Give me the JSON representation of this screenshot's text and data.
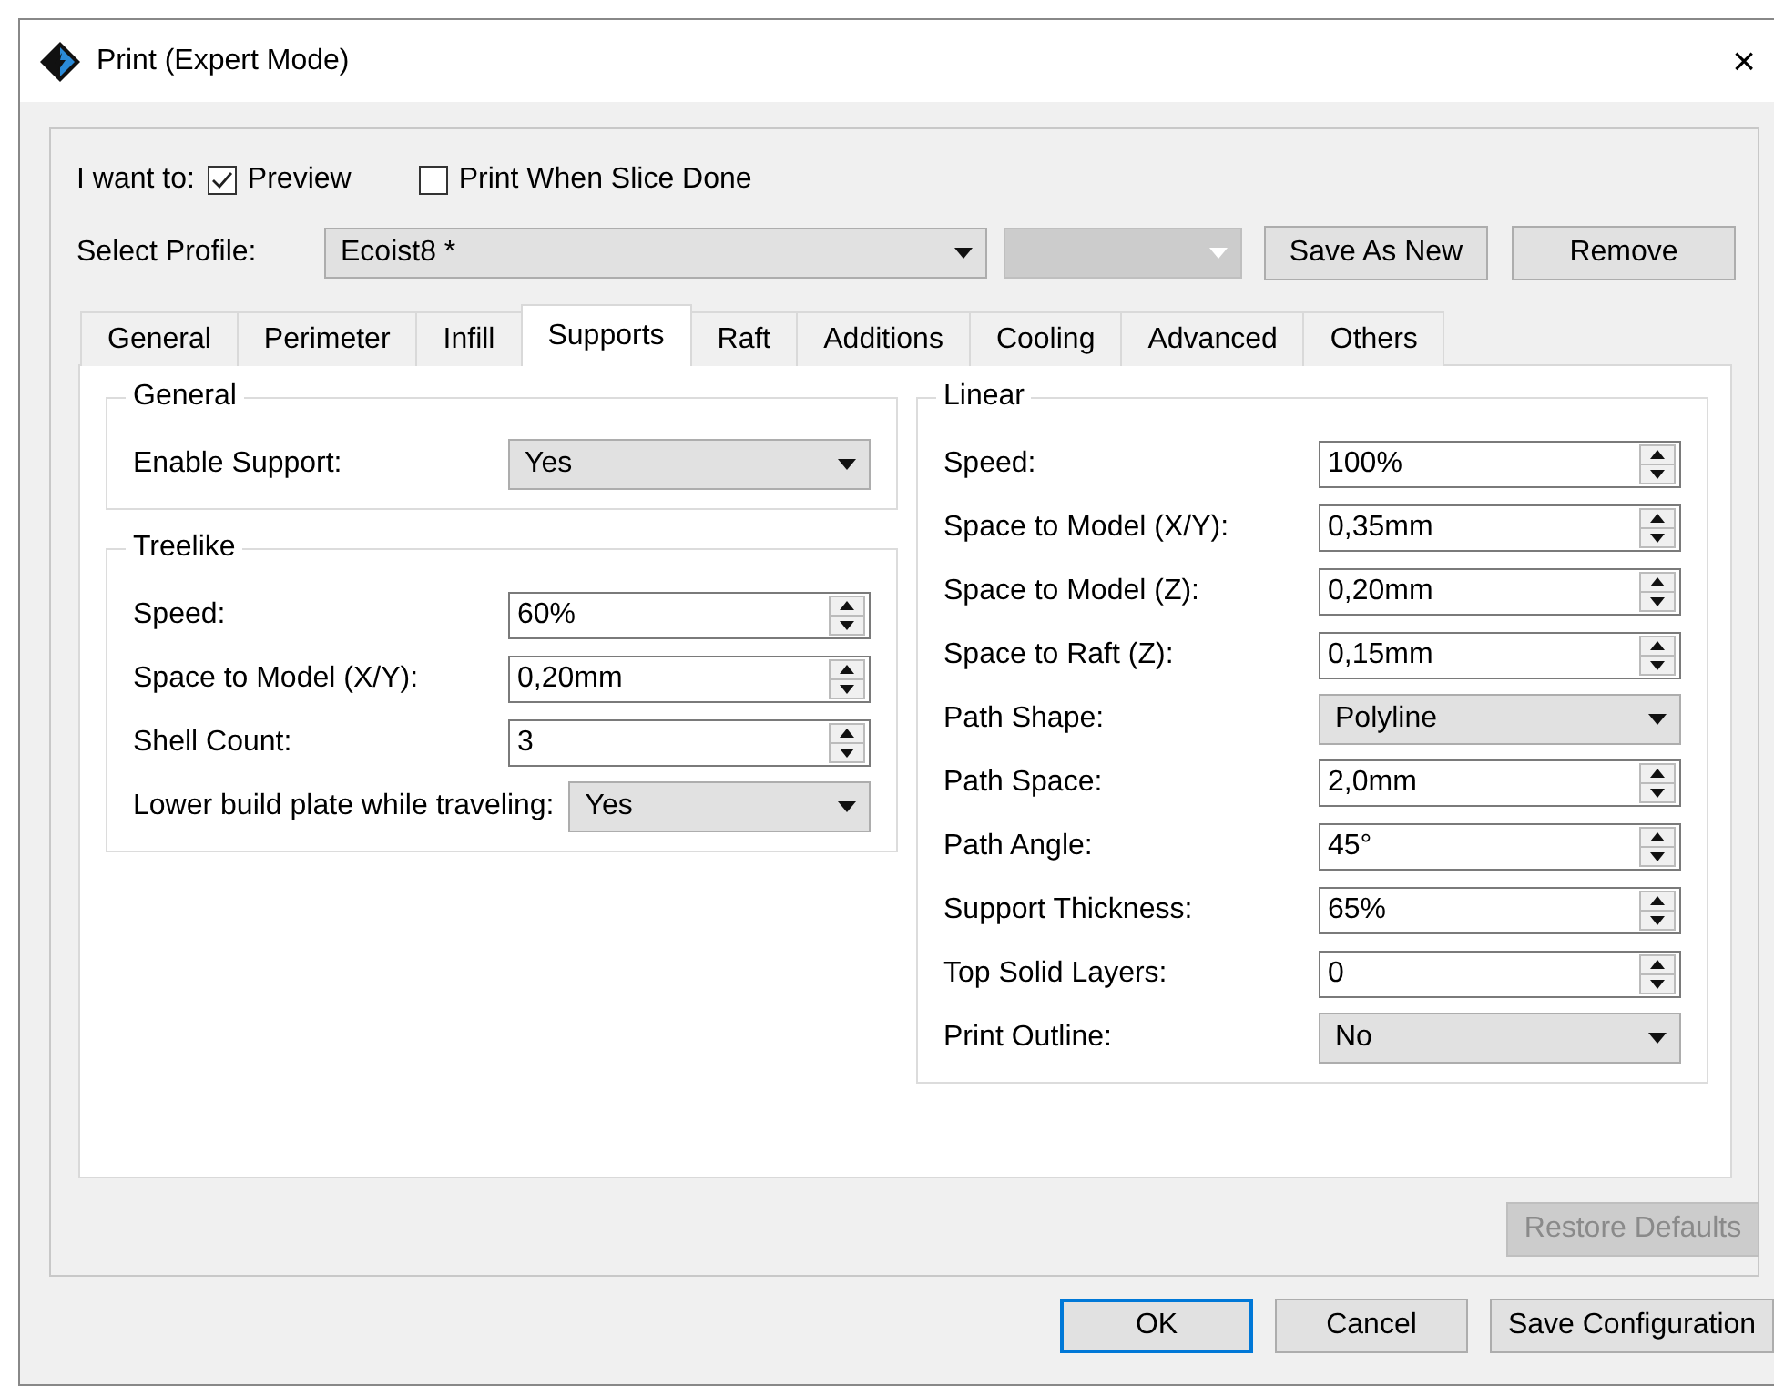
{
  "window": {
    "title": "Print (Expert Mode)",
    "close": "×"
  },
  "intent": {
    "label": "I want to:",
    "options": [
      {
        "label": "Preview",
        "checked": true
      },
      {
        "label": "Print When Slice Done",
        "checked": false
      }
    ]
  },
  "profile": {
    "label": "Select Profile:",
    "value": "Ecoist8 *",
    "secondary_disabled": true,
    "buttons": [
      "Save As New",
      "Remove"
    ]
  },
  "tabs": [
    {
      "label": "General",
      "selected": false
    },
    {
      "label": "Perimeter",
      "selected": false
    },
    {
      "label": "Infill",
      "selected": false
    },
    {
      "label": "Supports",
      "selected": true
    },
    {
      "label": "Raft",
      "selected": false
    },
    {
      "label": "Additions",
      "selected": false
    },
    {
      "label": "Cooling",
      "selected": false
    },
    {
      "label": "Advanced",
      "selected": false
    },
    {
      "label": "Others",
      "selected": false
    }
  ],
  "left_column": [
    {
      "title": "General",
      "rows": [
        {
          "kind": "combo",
          "label": "Enable Support:",
          "value": "Yes"
        }
      ]
    },
    {
      "title": "Treelike",
      "rows": [
        {
          "kind": "spin",
          "label": "Speed:",
          "value": "60%"
        },
        {
          "kind": "spin",
          "label": "Space to Model (X/Y):",
          "value": "0,20mm"
        },
        {
          "kind": "spin",
          "label": "Shell Count:",
          "value": "3"
        },
        {
          "kind": "combo",
          "label": "Lower build plate while traveling:",
          "value": "Yes"
        }
      ]
    }
  ],
  "right_column": [
    {
      "title": "Linear",
      "rows": [
        {
          "kind": "spin",
          "label": "Speed:",
          "value": "100%"
        },
        {
          "kind": "spin",
          "label": "Space to Model (X/Y):",
          "value": "0,35mm"
        },
        {
          "kind": "spin",
          "label": "Space to Model (Z):",
          "value": "0,20mm"
        },
        {
          "kind": "spin",
          "label": "Space to Raft (Z):",
          "value": "0,15mm"
        },
        {
          "kind": "combo",
          "label": "Path Shape:",
          "value": "Polyline"
        },
        {
          "kind": "spin",
          "label": "Path Space:",
          "value": "2,0mm"
        },
        {
          "kind": "spin",
          "label": "Path Angle:",
          "value": "45°"
        },
        {
          "kind": "spin",
          "label": "Support Thickness:",
          "value": "65%"
        },
        {
          "kind": "spin",
          "label": "Top Solid Layers:",
          "value": "0"
        },
        {
          "kind": "combo",
          "label": "Print Outline:",
          "value": "No"
        }
      ]
    }
  ],
  "restore_defaults": {
    "label": "Restore Defaults",
    "disabled": true
  },
  "buttons": [
    {
      "label": "OK",
      "focused": true
    },
    {
      "label": "Cancel",
      "focused": false
    },
    {
      "label": "Save Configuration",
      "focused": false
    }
  ]
}
